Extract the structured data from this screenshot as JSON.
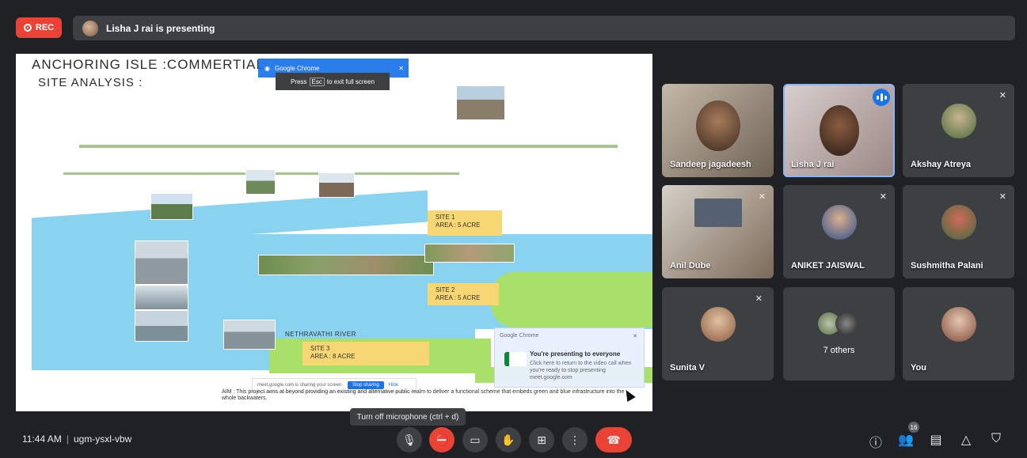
{
  "top_bar": {
    "rec_label": "REC",
    "presenting_text": "Lisha J rai is presenting"
  },
  "shared_screen": {
    "title": "ANCHORING ISLE :COMMERTIAL",
    "subtitle": "SITE ANALYSIS :",
    "chrome_chip": "Google Chrome",
    "fullscreen_hint": {
      "prefix": "Press",
      "key": "Esc",
      "suffix": "to exit full screen"
    },
    "site_labels": [
      {
        "line1": "SITE 1",
        "line2": "AREA : 5 ACRE"
      },
      {
        "line1": "SITE 2",
        "line2": "AREA : 5 ACRE"
      },
      {
        "line1": "SITE 3",
        "line2": "AREA : 8 ACRE"
      }
    ],
    "river_label": "NETHRAVATHI RIVER",
    "share_pill": {
      "text": "meet.google.com is sharing your screen.",
      "stop": "Stop sharing",
      "hide": "Hide"
    },
    "aim_text": "AIM : This project aims at beyond providing an existing and alternative public realm to deliver a functional scheme that embeds green and blue infrastructure into the whole backwaters.",
    "toast": {
      "app": "Google Chrome",
      "title": "You're presenting to everyone",
      "body": "Click here to return to the video call when you're ready to stop presenting",
      "url": "meet.google.com"
    }
  },
  "participants": [
    {
      "name": "Sandeep jagadeesh",
      "muted": false,
      "speaking": false
    },
    {
      "name": "Lisha J rai",
      "muted": false,
      "speaking": true
    },
    {
      "name": "Akshay Atreya",
      "muted": true,
      "speaking": false
    },
    {
      "name": "Anil Dube",
      "muted": true,
      "speaking": false
    },
    {
      "name": "ANIKET JAISWAL",
      "muted": true,
      "speaking": false
    },
    {
      "name": "Sushmitha Palani",
      "muted": true,
      "speaking": false
    },
    {
      "name": "Sunita V",
      "muted": true,
      "speaking": false
    },
    {
      "name": "7 others",
      "muted": false,
      "speaking": false
    },
    {
      "name": "You",
      "muted": false,
      "speaking": false
    }
  ],
  "tooltip": "Turn off microphone (ctrl + d)",
  "bottom_bar": {
    "time": "11:44 AM",
    "meeting_code": "ugm-ysxl-vbw",
    "participant_count": "16",
    "icons": {
      "mic": "microphone-icon",
      "camera": "camera-off-icon",
      "captions": "captions-icon",
      "hand": "raise-hand-icon",
      "present": "present-icon",
      "more": "more-options-icon",
      "end": "end-call-icon",
      "info": "info-icon",
      "people": "people-icon",
      "chat": "chat-icon",
      "activities": "activities-icon",
      "host": "host-controls-icon"
    }
  }
}
